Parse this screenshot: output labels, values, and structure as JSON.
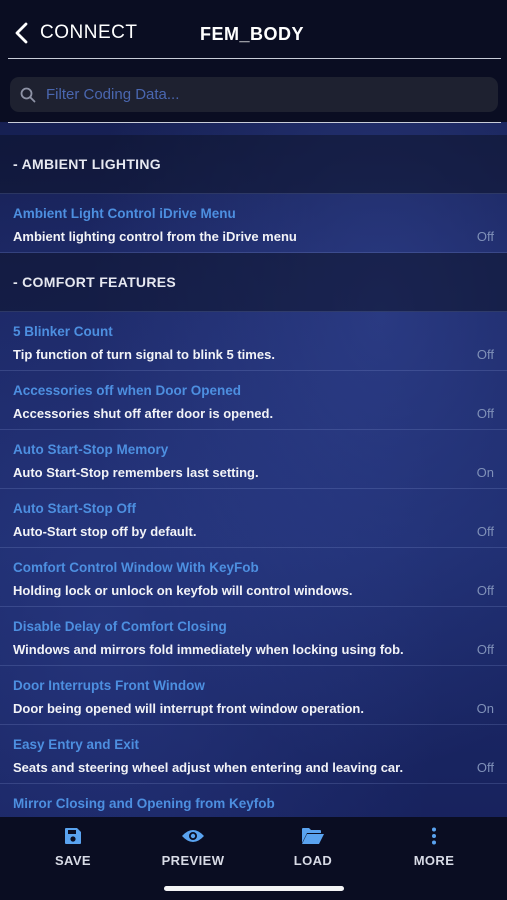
{
  "header": {
    "back_label": "CONNECT",
    "title": "FEM_BODY",
    "back_icon": "chevron-left-icon"
  },
  "search": {
    "placeholder": "Filter Coding Data...",
    "value": "",
    "icon": "search-icon"
  },
  "sections": [
    {
      "label": "- AMBIENT LIGHTING",
      "items": [
        {
          "title": "Ambient Light Control iDrive Menu",
          "desc": "Ambient lighting control from the iDrive menu",
          "value": "Off"
        }
      ]
    },
    {
      "label": "- COMFORT FEATURES",
      "items": [
        {
          "title": "5 Blinker Count",
          "desc": "Tip function of turn signal to blink 5 times.",
          "value": "Off"
        },
        {
          "title": "Accessories off when Door Opened",
          "desc": "Accessories shut off after door is opened.",
          "value": "Off"
        },
        {
          "title": "Auto Start-Stop Memory",
          "desc": "Auto Start-Stop remembers last setting.",
          "value": "On"
        },
        {
          "title": "Auto Start-Stop Off",
          "desc": "Auto-Start stop off by default.",
          "value": "Off"
        },
        {
          "title": "Comfort Control Window With KeyFob",
          "desc": "Holding lock or unlock on keyfob will control windows.",
          "value": "Off"
        },
        {
          "title": "Disable Delay of Comfort Closing",
          "desc": "Windows and mirrors fold immediately when locking using fob.",
          "value": "Off"
        },
        {
          "title": "Door Interrupts Front Window",
          "desc": "Door being opened will interrupt front window operation.",
          "value": "On"
        },
        {
          "title": "Easy Entry and Exit",
          "desc": "Seats and steering wheel adjust when entering and leaving car.",
          "value": "Off"
        },
        {
          "title": "Mirror Closing and Opening from Keyfob",
          "desc": "",
          "value": ""
        }
      ]
    }
  ],
  "toolbar": {
    "save_label": "SAVE",
    "preview_label": "PREVIEW",
    "load_label": "LOAD",
    "more_label": "MORE",
    "icons": [
      "save-icon",
      "eye-icon",
      "folder-open-icon",
      "more-vertical-icon"
    ]
  },
  "colors": {
    "accent": "#4d8fe0",
    "header_bg": "#0a0d22",
    "placeholder": "#4a67b0",
    "value_text": "#7f90b8"
  }
}
